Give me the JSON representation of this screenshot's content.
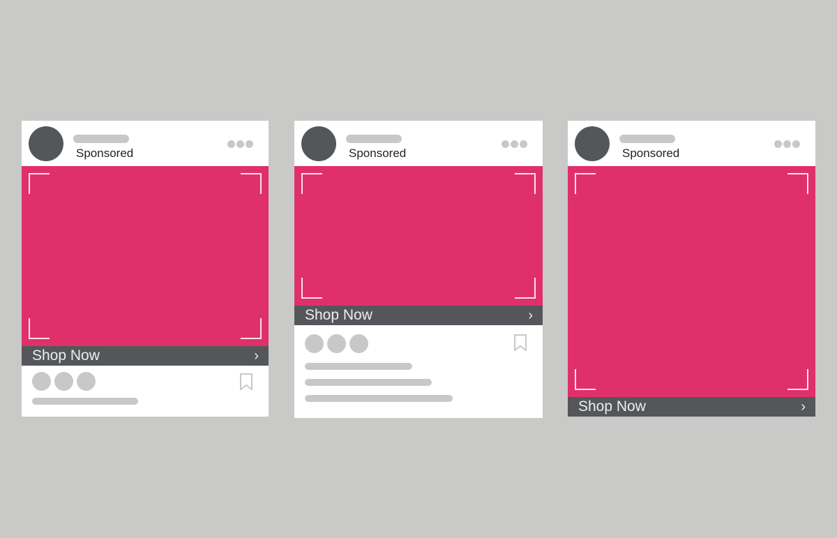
{
  "colors": {
    "background": "#c9c9c7",
    "image": "#e0306b",
    "cta_bar": "#54565a",
    "placeholder": "#c8c8c8"
  },
  "cards": [
    {
      "sponsored_label": "Sponsored",
      "cta_label": "Shop Now",
      "chevron": "›"
    },
    {
      "sponsored_label": "Sponsored",
      "cta_label": "Shop Now",
      "chevron": "›"
    },
    {
      "sponsored_label": "Sponsored",
      "cta_label": "Shop Now",
      "chevron": "›"
    }
  ]
}
